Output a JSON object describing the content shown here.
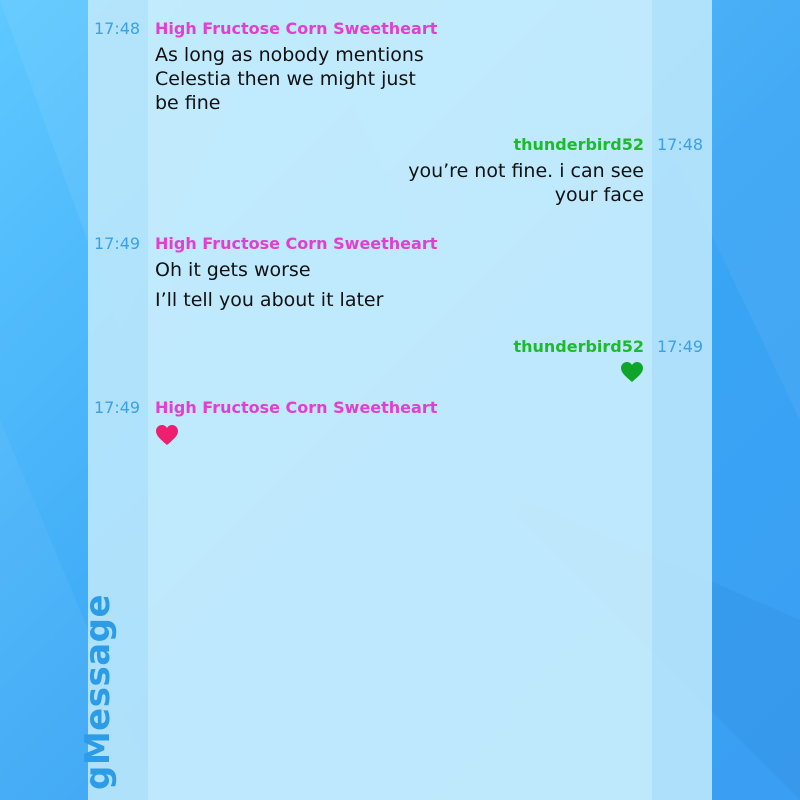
{
  "app": {
    "name": "gMessage"
  },
  "colors": {
    "background": "#3aa6f5",
    "stripe": "#c6ecfc",
    "sender_left": "#e23fd0",
    "sender_right": "#1dbb2c",
    "timestamp": "#3aa0e8",
    "heart_green": "#10a52a",
    "heart_pink": "#ee1f6e"
  },
  "messages": [
    {
      "time": "17:48",
      "sender": "High Fructose Corn Sweetheart",
      "lines": [
        "As long as nobody mentions",
        "Celestia then we might just",
        "be fine"
      ]
    },
    {
      "time": "17:48",
      "sender": "thunderbird52",
      "lines": [
        "you’re not fine. i can see",
        "your face"
      ]
    },
    {
      "time": "17:49",
      "sender": "High Fructose Corn Sweetheart",
      "lines": [
        "Oh it gets worse",
        "I’ll tell you about it later"
      ]
    },
    {
      "time": "17:49",
      "sender": "thunderbird52",
      "icon": "green-heart-icon"
    },
    {
      "time": "17:49",
      "sender": "High Fructose Corn Sweetheart",
      "icon": "pink-heart-icon"
    }
  ]
}
